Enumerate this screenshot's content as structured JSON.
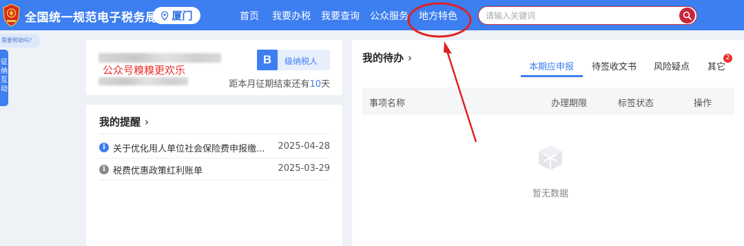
{
  "header": {
    "site_title": "全国统一规范电子税务局",
    "city": "厦门",
    "nav": [
      {
        "label": "首页"
      },
      {
        "label": "我要办税"
      },
      {
        "label": "我要查询"
      },
      {
        "label": "公众服务"
      },
      {
        "label": "地方特色"
      }
    ],
    "search": {
      "placeholder": "请输入关键词",
      "value": ""
    }
  },
  "side": {
    "help_bubble": "需要帮助吗?",
    "help_tab": "征纳互动"
  },
  "profile": {
    "watermark": "公众号糗糗更欢乐",
    "level_letter": "B",
    "level_label": "级纳税人",
    "deadline_prefix": "距本月征期结束还有",
    "deadline_days": "10",
    "deadline_suffix": "天"
  },
  "reminders": {
    "title": "我的提醒",
    "items": [
      {
        "text": "关于优化用人单位社会保险费申报缴...",
        "date": "2025-04-28",
        "icon": "info-icon",
        "icon_color": "#3d7ef0"
      },
      {
        "text": "税费优惠政策红利账单",
        "date": "2025-03-29",
        "icon": "info-icon",
        "icon_color": "#8a8a8a"
      }
    ]
  },
  "todo": {
    "title": "我的待办",
    "tabs": [
      {
        "label": "本期应申报",
        "active": true
      },
      {
        "label": "待签收文书",
        "active": false
      },
      {
        "label": "风险疑点",
        "active": false
      },
      {
        "label": "其它",
        "active": false,
        "badge": "2"
      }
    ],
    "columns": [
      "事项名称",
      "办理期限",
      "标签状态",
      "操作"
    ],
    "empty_text": "暂无数据"
  },
  "colors": {
    "brand_blue": "#3d7ef0",
    "search_red": "#c9243a",
    "annotation_red": "#e02020"
  }
}
